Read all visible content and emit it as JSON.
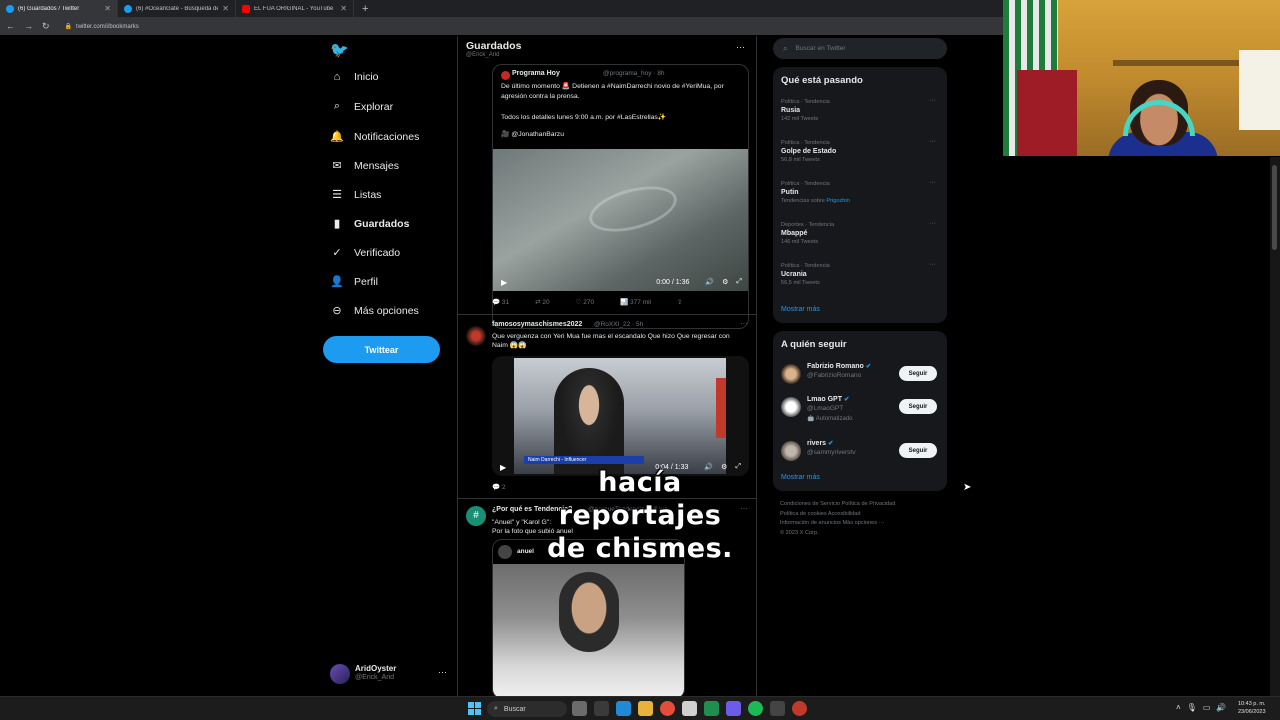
{
  "browser": {
    "tabs": [
      {
        "title": "(6) Guardados / Twitter",
        "icon": "twitter-icon"
      },
      {
        "title": "(6) #OceanGate - Búsqueda de Twitter",
        "icon": "twitter-icon"
      },
      {
        "title": "EL FUA ORIGINAL - YouTube",
        "icon": "youtube-icon"
      }
    ],
    "new_tab": "+",
    "url": "twitter.com/i/bookmarks"
  },
  "nav": {
    "items": [
      {
        "label": "Inicio",
        "icon": "home-icon"
      },
      {
        "label": "Explorar",
        "icon": "search-icon"
      },
      {
        "label": "Notificaciones",
        "icon": "bell-icon"
      },
      {
        "label": "Mensajes",
        "icon": "mail-icon"
      },
      {
        "label": "Listas",
        "icon": "list-icon"
      },
      {
        "label": "Guardados",
        "icon": "bookmark-icon"
      },
      {
        "label": "Verificado",
        "icon": "verified-icon"
      },
      {
        "label": "Perfil",
        "icon": "person-icon"
      },
      {
        "label": "Más opciones",
        "icon": "more-icon"
      }
    ],
    "tweet_button": "Twittear",
    "account": {
      "name": "AridOyster",
      "handle": "@Erick_Arid"
    }
  },
  "main": {
    "title": "Guardados",
    "subtitle": "@Erick_Arid",
    "tweet1": {
      "name": "Programa Hoy",
      "handle": "@programa_hoy · 8h",
      "text": "De último momento 🚨 Detienen a #NaimDarrechi novio de #YeriMua, por agresión contra la prensa.",
      "text2": "Todos los detalles lunes 9:00 a.m. por #LasEstrellas✨",
      "text3": "🎥 @JonathanBarzu",
      "video_time": "0:00 / 1:36",
      "actions": {
        "replies": "31",
        "retweets": "20",
        "likes": "270",
        "views": "377 mil"
      }
    },
    "tweet2": {
      "name": "famososymaschismes2022",
      "handle": "@RoXXI_22 · 5h",
      "text": "Que verguenza con Yeri Mua fue mas el escandalo Que hizo Que regresar con Naim 😱😱",
      "video_banner": "Naim Darrechi - Influencer",
      "video_time": "0:04 / 1:33",
      "actions": {
        "replies": "2"
      }
    },
    "tweet3": {
      "name": "¿Por qué es Tendencia?",
      "handle": "@porqueTendencia · 16 jun.",
      "text": "\"Anuel\" y \"Karol G\":\nPor la foto que subió anuel",
      "quote_name": "anuel"
    },
    "caption_line1": "hacía reportajes",
    "caption_line2": "de chismes."
  },
  "sidebar": {
    "search_placeholder": "Buscar en Twitter",
    "trends_title": "Qué está pasando",
    "trends": [
      {
        "context": "Política · Tendencia",
        "name": "Rusia",
        "count": "142 mil Tweets"
      },
      {
        "context": "Política · Tendencia",
        "name": "Golpe de Estado",
        "count": "56,8 mil Tweets"
      },
      {
        "context": "Política · Tendencia",
        "name": "Putin",
        "count": "Tendencias sobre ",
        "link": "Prigozhin"
      },
      {
        "context": "Deportes · Tendencia",
        "name": "Mbappé",
        "count": "146 mil Tweets"
      },
      {
        "context": "Política · Tendencia",
        "name": "Ucrania",
        "count": "56,5 mil Tweets"
      }
    ],
    "show_more": "Mostrar más",
    "follow_title": "A quién seguir",
    "who_to_follow": [
      {
        "name": "Fabrizio Romano",
        "handle": "@FabrizioRomano",
        "extra": "",
        "button": "Seguir"
      },
      {
        "name": "Lmao GPT",
        "handle": "@LmaoGPT",
        "extra": "🤖 Automatizado",
        "button": "Seguir"
      },
      {
        "name": "rivers",
        "handle": "@sammyriverstv",
        "extra": "",
        "button": "Seguir"
      }
    ],
    "footer": [
      "Condiciones de Servicio   Política de Privacidad",
      "Política de cookies   Accesibilidad",
      "Información de anuncios   Más opciones ···",
      "© 2023 X Corp."
    ]
  },
  "taskbar": {
    "search_label": "Buscar",
    "time": "10:43 p. m.",
    "date": "23/06/2023"
  },
  "colors": {
    "accent": "#1d9bf0",
    "background": "#000000",
    "panel": "#16181c"
  }
}
